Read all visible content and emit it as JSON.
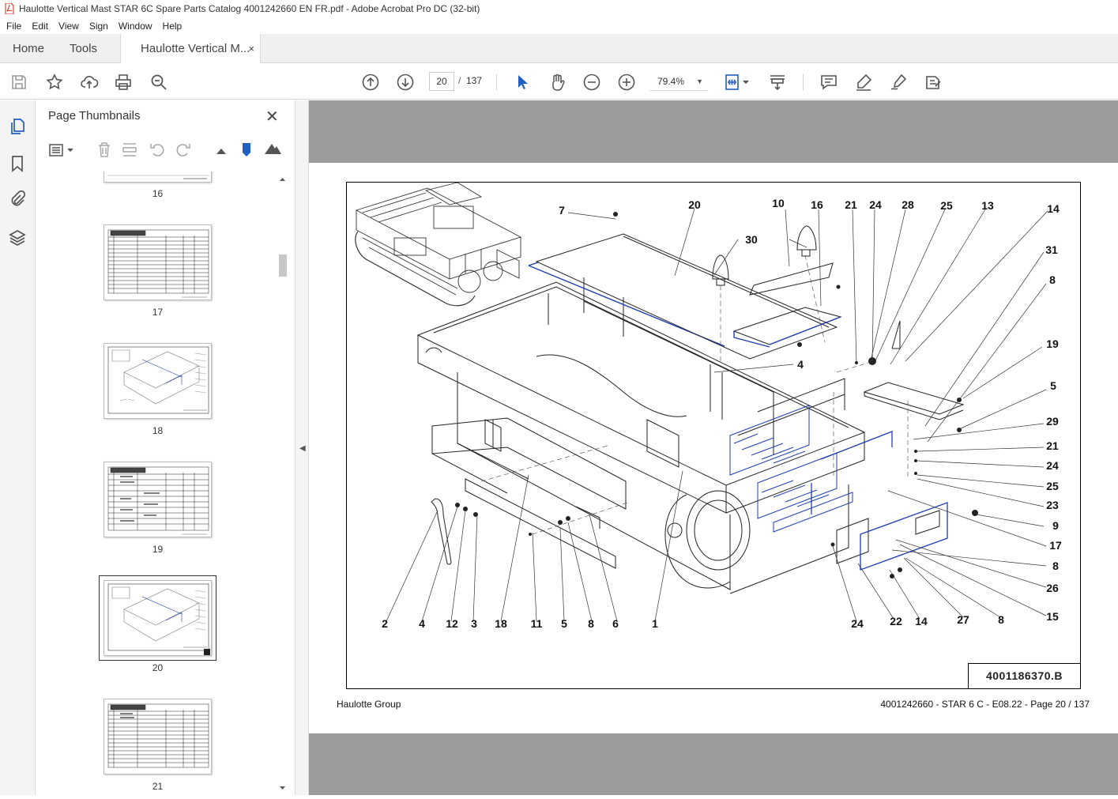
{
  "window": {
    "title": "Haulotte Vertical Mast STAR 6C Spare Parts Catalog 4001242660 EN FR.pdf - Adobe Acrobat Pro DC (32-bit)"
  },
  "menu": [
    "File",
    "Edit",
    "View",
    "Sign",
    "Window",
    "Help"
  ],
  "tabs": {
    "home": "Home",
    "tools": "Tools",
    "document": "Haulotte Vertical M...",
    "close_glyph": "×"
  },
  "toolbar": {
    "current_page": "20",
    "page_separator": "/",
    "total_pages": "137",
    "zoom": "79.4%"
  },
  "thumbnail_panel": {
    "title": "Page Thumbnails",
    "close_glyph": "✕",
    "pages": [
      {
        "label": "16",
        "kind": "table"
      },
      {
        "label": "17",
        "kind": "table"
      },
      {
        "label": "18",
        "kind": "drawing"
      },
      {
        "label": "19",
        "kind": "table"
      },
      {
        "label": "20",
        "kind": "drawing",
        "selected": true
      },
      {
        "label": "21",
        "kind": "table"
      }
    ]
  },
  "document_page": {
    "drawing_reference": "4001186370.B",
    "footer_left": "Haulotte Group",
    "footer_right": "4001242660 - STAR 6 C - E08.22 - Page 20 / 137",
    "callouts": [
      {
        "n": "7"
      },
      {
        "n": "20"
      },
      {
        "n": "10"
      },
      {
        "n": "16"
      },
      {
        "n": "21"
      },
      {
        "n": "24"
      },
      {
        "n": "28"
      },
      {
        "n": "25"
      },
      {
        "n": "13"
      },
      {
        "n": "14"
      },
      {
        "n": "30"
      },
      {
        "n": "31"
      },
      {
        "n": "8"
      },
      {
        "n": "4"
      },
      {
        "n": "19"
      },
      {
        "n": "5"
      },
      {
        "n": "29"
      },
      {
        "n": "21"
      },
      {
        "n": "24"
      },
      {
        "n": "25"
      },
      {
        "n": "23"
      },
      {
        "n": "9"
      },
      {
        "n": "17"
      },
      {
        "n": "8"
      },
      {
        "n": "26"
      },
      {
        "n": "15"
      },
      {
        "n": "2"
      },
      {
        "n": "4"
      },
      {
        "n": "12"
      },
      {
        "n": "3"
      },
      {
        "n": "18"
      },
      {
        "n": "11"
      },
      {
        "n": "5"
      },
      {
        "n": "8"
      },
      {
        "n": "6"
      },
      {
        "n": "1"
      },
      {
        "n": "24"
      },
      {
        "n": "22"
      },
      {
        "n": "14"
      },
      {
        "n": "27"
      },
      {
        "n": "8"
      }
    ]
  },
  "colors": {
    "accent_blue": "#1f3cb5",
    "viewer_gray": "#9b9b9b",
    "pdf_red": "#d3231c"
  }
}
